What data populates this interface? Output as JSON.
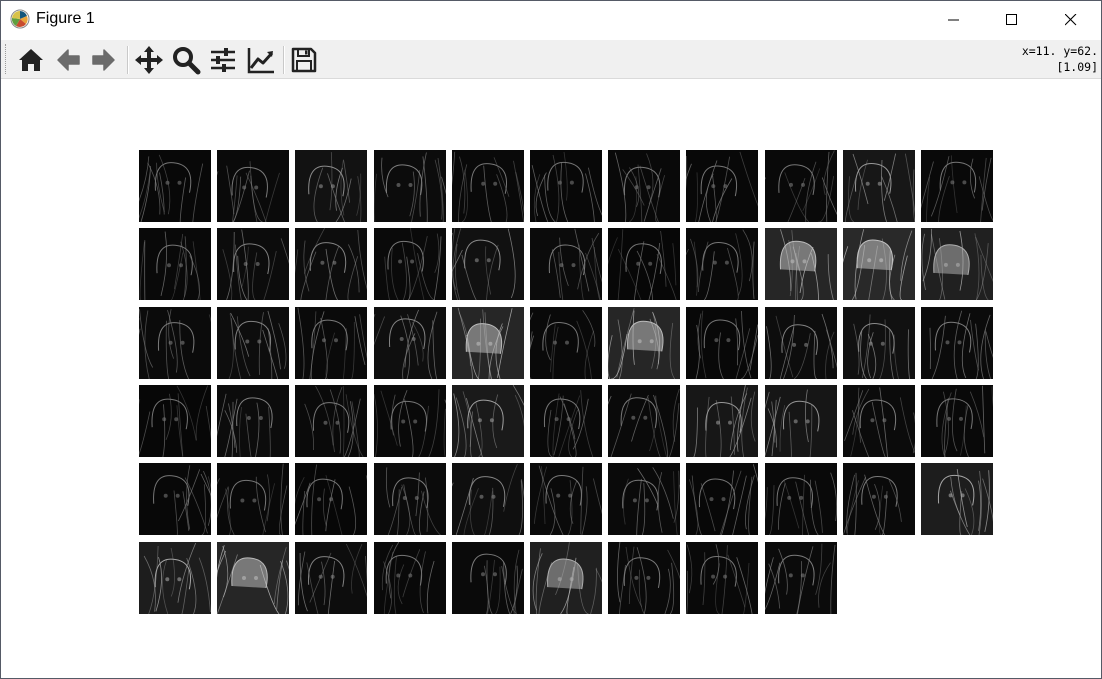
{
  "window": {
    "title": "Figure 1",
    "app_icon": "matplotlib-icon",
    "controls": [
      "minimize-icon",
      "maximize-icon",
      "close-icon"
    ]
  },
  "toolbar": {
    "buttons": [
      {
        "name": "home-button",
        "icon": "home-icon",
        "tooltip": "Reset original view"
      },
      {
        "name": "back-button",
        "icon": "arrow-left-icon",
        "tooltip": "Back"
      },
      {
        "name": "forward-button",
        "icon": "arrow-right-icon",
        "tooltip": "Forward"
      },
      {
        "name": "pan-button",
        "icon": "move-icon",
        "tooltip": "Pan"
      },
      {
        "name": "zoom-button",
        "icon": "magnifier-icon",
        "tooltip": "Zoom"
      },
      {
        "name": "subplots-button",
        "icon": "sliders-icon",
        "tooltip": "Configure subplots"
      },
      {
        "name": "edit-button",
        "icon": "line-chart-icon",
        "tooltip": "Edit axis"
      },
      {
        "name": "save-button",
        "icon": "floppy-disk-icon",
        "tooltip": "Save the figure"
      }
    ],
    "coords_line1": "x=11. y=62.",
    "coords_line2": "[1.09]"
  },
  "figure": {
    "grid_columns": 11,
    "grid_rows": 6,
    "feature_map_count": 64,
    "tiles": [
      {
        "tone": 0.05
      },
      {
        "tone": 0.08
      },
      {
        "tone": 0.22
      },
      {
        "tone": 0.12
      },
      {
        "tone": 0.06
      },
      {
        "tone": 0.05
      },
      {
        "tone": 0.07
      },
      {
        "tone": 0.05
      },
      {
        "tone": 0.06
      },
      {
        "tone": 0.3
      },
      {
        "tone": 0.06
      },
      {
        "tone": 0.06
      },
      {
        "tone": 0.12
      },
      {
        "tone": 0.14
      },
      {
        "tone": 0.08
      },
      {
        "tone": 0.2
      },
      {
        "tone": 0.1
      },
      {
        "tone": 0.04
      },
      {
        "tone": 0.06
      },
      {
        "tone": 0.55
      },
      {
        "tone": 0.6
      },
      {
        "tone": 0.45
      },
      {
        "tone": 0.1
      },
      {
        "tone": 0.14
      },
      {
        "tone": 0.08
      },
      {
        "tone": 0.16
      },
      {
        "tone": 0.55
      },
      {
        "tone": 0.06
      },
      {
        "tone": 0.55
      },
      {
        "tone": 0.05
      },
      {
        "tone": 0.14
      },
      {
        "tone": 0.2
      },
      {
        "tone": 0.1
      },
      {
        "tone": 0.04
      },
      {
        "tone": 0.12
      },
      {
        "tone": 0.08
      },
      {
        "tone": 0.06
      },
      {
        "tone": 0.35
      },
      {
        "tone": 0.06
      },
      {
        "tone": 0.08
      },
      {
        "tone": 0.3
      },
      {
        "tone": 0.28
      },
      {
        "tone": 0.1
      },
      {
        "tone": 0.06
      },
      {
        "tone": 0.05
      },
      {
        "tone": 0.06
      },
      {
        "tone": 0.04
      },
      {
        "tone": 0.1
      },
      {
        "tone": 0.16
      },
      {
        "tone": 0.08
      },
      {
        "tone": 0.08
      },
      {
        "tone": 0.05
      },
      {
        "tone": 0.06
      },
      {
        "tone": 0.08
      },
      {
        "tone": 0.4
      },
      {
        "tone": 0.4
      },
      {
        "tone": 0.55
      },
      {
        "tone": 0.14
      },
      {
        "tone": 0.06
      },
      {
        "tone": 0.08
      },
      {
        "tone": 0.45
      },
      {
        "tone": 0.08
      },
      {
        "tone": 0.06
      },
      {
        "tone": 0.1
      }
    ]
  }
}
